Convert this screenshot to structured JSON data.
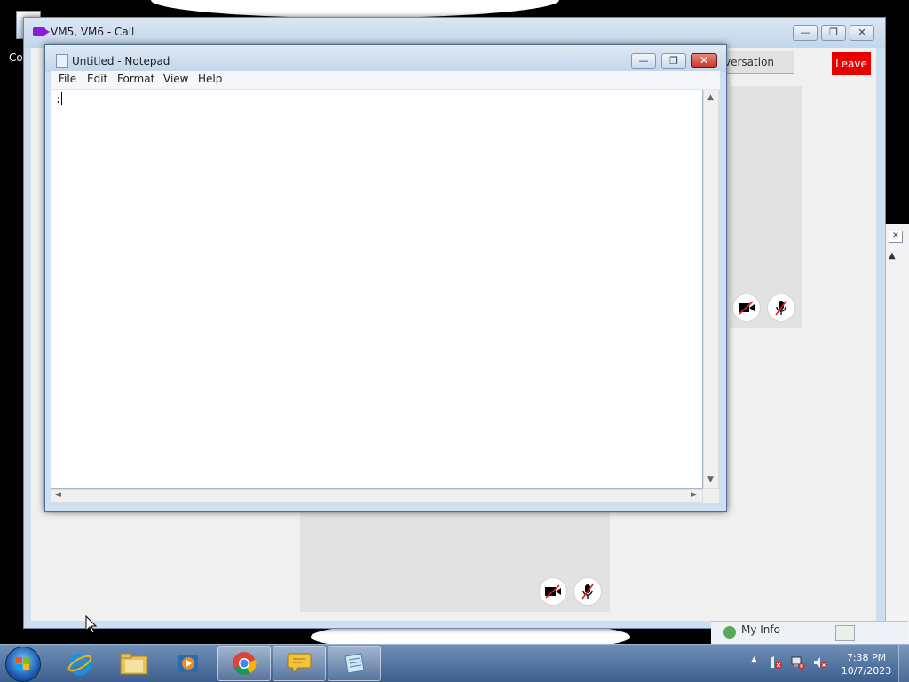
{
  "desktop": {
    "icon_label": "Co"
  },
  "call_window": {
    "title": "VM5, VM6 - Call",
    "conversation_button": "versation",
    "leave_button": "Leave",
    "minimize_label": "—",
    "restore_label": "❐",
    "close_label": "✕",
    "video_off_icon": "video-off",
    "mic_off_icon": "mic-off",
    "leave_color": "#e60000"
  },
  "side_panel": {
    "close_label": "✕",
    "up_arrow": "▲",
    "my_info_label": "My Info"
  },
  "notepad": {
    "title": "Untitled - Notepad",
    "menu": [
      "File",
      "Edit",
      "Format",
      "View",
      "Help"
    ],
    "content": ":",
    "minimize_label": "—",
    "restore_label": "❐",
    "close_label": "✕",
    "scroll_up": "▲",
    "scroll_down": "▼",
    "scroll_left": "◄",
    "scroll_right": "►"
  },
  "taskbar": {
    "pinned_icons": [
      "internet-explorer",
      "file-explorer",
      "media-player",
      "chrome",
      "chat-app",
      "notepad"
    ],
    "tray_arrow": "▲",
    "time": "7:38 PM",
    "date": "10/7/2023"
  }
}
